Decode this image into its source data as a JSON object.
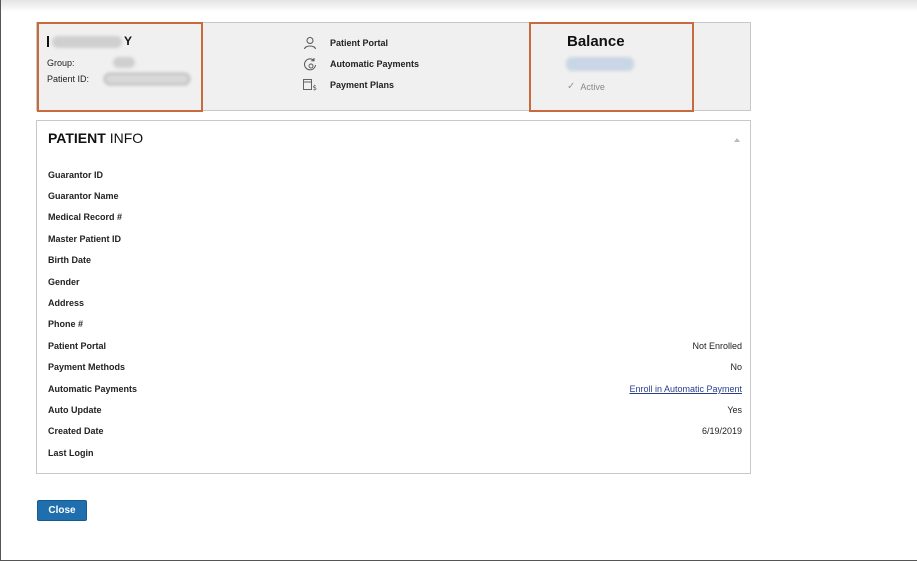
{
  "patient": {
    "name_suffix": "Y",
    "group_label": "Group:",
    "patient_id_label": "Patient ID:"
  },
  "links": [
    {
      "label": "Patient Portal",
      "icon": "user-icon"
    },
    {
      "label": "Automatic Payments",
      "icon": "autopay-icon"
    },
    {
      "label": "Payment Plans",
      "icon": "calendar-dollar-icon"
    }
  ],
  "balance": {
    "title": "Balance",
    "status": "Active"
  },
  "info": {
    "title_bold": "PATIENT",
    "title_rest": " INFO",
    "rows": [
      {
        "label": "Guarantor ID",
        "value": ""
      },
      {
        "label": "Guarantor Name",
        "value": ""
      },
      {
        "label": "Medical Record #",
        "value": ""
      },
      {
        "label": "Master Patient ID",
        "value": ""
      },
      {
        "label": "Birth Date",
        "value": ""
      },
      {
        "label": "Gender",
        "value": ""
      },
      {
        "label": "Address",
        "value": ""
      },
      {
        "label": "Phone #",
        "value": ""
      },
      {
        "label": "Patient Portal",
        "value": "Not Enrolled"
      },
      {
        "label": "Payment Methods",
        "value": "No"
      },
      {
        "label": "Automatic Payments",
        "value": "Enroll in Automatic Payment"
      },
      {
        "label": "Auto Update",
        "value": "Yes"
      },
      {
        "label": "Created Date",
        "value": "6/19/2019"
      },
      {
        "label": "Last Login",
        "value": ""
      }
    ]
  },
  "close_label": "Close",
  "colors": {
    "highlight": "#c86a3c",
    "button": "#1f6fae",
    "link": "#2a3f8f"
  }
}
